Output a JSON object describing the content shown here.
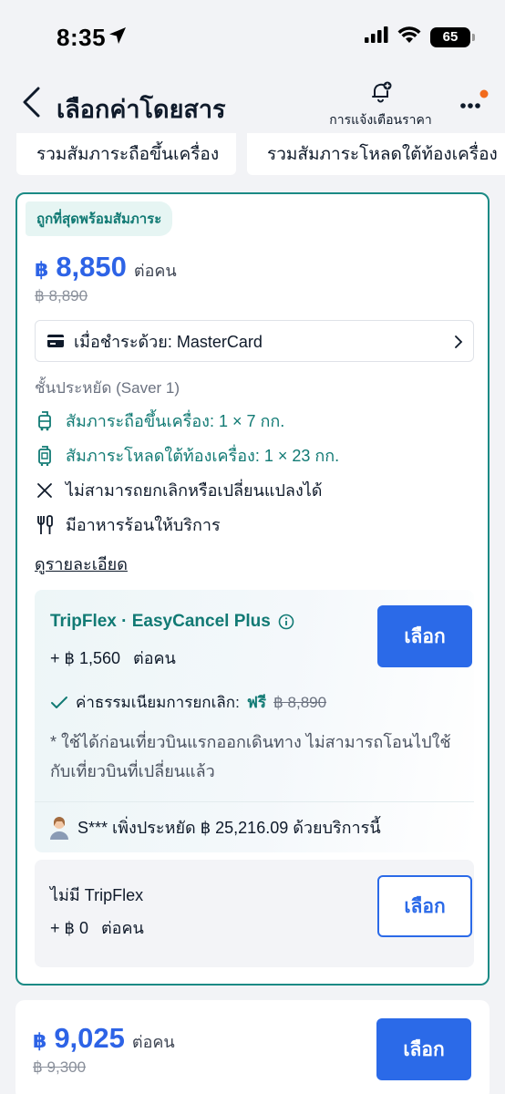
{
  "status_bar": {
    "time": "8:35",
    "battery": "65"
  },
  "header": {
    "title": "เลือกค่าโดยสาร",
    "alert_label": "การแจ้งเตือนราคา"
  },
  "tabs": [
    {
      "label": "รวมสัมภาระถือขึ้นเครื่อง"
    },
    {
      "label": "รวมสัมภาระโหลดใต้ท้องเครื่อง"
    }
  ],
  "fare_main": {
    "badge": "ถูกที่สุดพร้อมสัมภาระ",
    "currency": "฿",
    "price": "8,850",
    "per_person": "ต่อคน",
    "original_price": "฿ 8,890",
    "payment_method": "เมื่อชำระด้วย: MasterCard",
    "fare_class": "ชั้นประหยัด (Saver 1)",
    "features": [
      {
        "icon": "carry-on-bag-icon",
        "text": "สัมภาระถือขึ้นเครื่อง: 1 × 7 กก."
      },
      {
        "icon": "checked-bag-icon",
        "text": "สัมภาระโหลดใต้ท้องเครื่อง: 1 × 23 กก."
      },
      {
        "icon": "close-icon",
        "text": "ไม่สามารถยกเลิกหรือเปลี่ยนแปลงได้"
      },
      {
        "icon": "cutlery-icon",
        "text": "มีอาหารร้อนให้บริการ"
      }
    ],
    "details_link": "ดูรายละเอียด",
    "tripflex": {
      "name": "TripFlex · EasyCancel Plus",
      "add_price": "+ ฿ 1,560",
      "per_person": "ต่อคน",
      "select_label": "เลือก",
      "fee_label": "ค่าธรรมเนียมการยกเลิก:",
      "fee_free": "ฟรี",
      "fee_original": "฿ 8,890",
      "note": "* ใช้ได้ก่อนเที่ยวบินแรกออกเดินทาง ไม่สามารถโอนไปใช้กับเที่ยวบินที่เปลี่ยนแล้ว",
      "saving": "S*** เพิ่งประหยัด ฿ 25,216.09 ด้วยบริการนี้"
    },
    "no_tripflex": {
      "name": "ไม่มี TripFlex",
      "add_price": "+ ฿ 0",
      "per_person": "ต่อคน",
      "select_label": "เลือก"
    }
  },
  "fare_second": {
    "currency": "฿",
    "price": "9,025",
    "per_person": "ต่อคน",
    "original_price": "฿ 9,300",
    "select_label": "เลือก"
  },
  "colors": {
    "accent_blue": "#2b6ae8",
    "teal": "#117a74",
    "notification_dot": "#f26b1d"
  }
}
